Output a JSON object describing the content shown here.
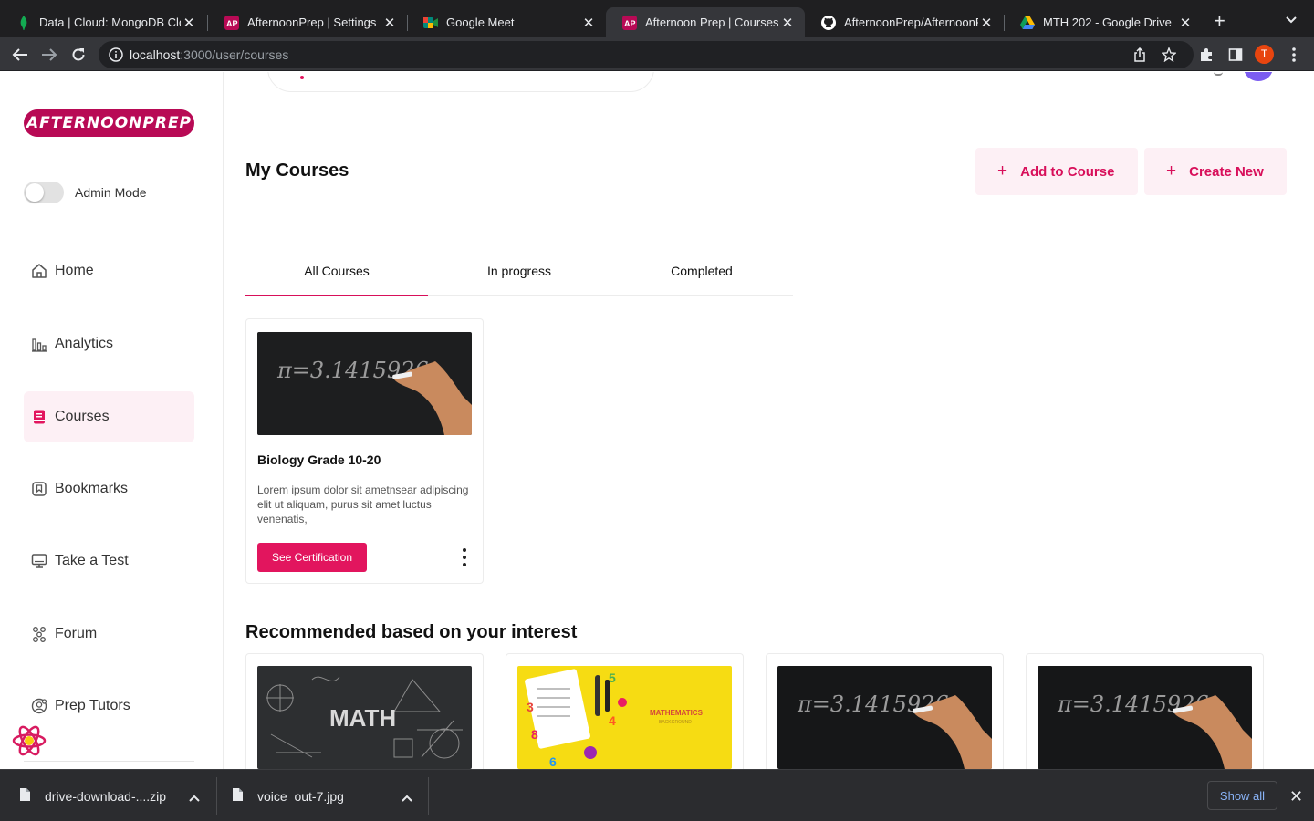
{
  "browser": {
    "tabs": [
      {
        "title": "Data | Cloud: MongoDB Clo",
        "icon": "mongodb-leaf-icon"
      },
      {
        "title": "AfternoonPrep | Settings",
        "icon": "afternoonprep-icon"
      },
      {
        "title": "Google Meet",
        "icon": "google-meet-icon"
      },
      {
        "title": "Afternoon Prep | Courses",
        "icon": "afternoonprep-icon"
      },
      {
        "title": "AfternoonPrep/AfternoonPr",
        "icon": "github-icon"
      },
      {
        "title": "MTH 202 - Google Drive",
        "icon": "google-drive-icon"
      }
    ],
    "active_tab": 3,
    "url_host": "localhost",
    "url_path": ":3000/user/courses",
    "profile_initial": "T",
    "colors": {
      "tabbar": "#1f1f21",
      "toolbar": "#35363a",
      "profile": "#e8450f"
    }
  },
  "sidebar": {
    "logo_text": "AFTERNOONPREP",
    "admin_label": "Admin Mode",
    "admin_on": false,
    "items": [
      {
        "label": "Home",
        "icon": "home-icon"
      },
      {
        "label": "Analytics",
        "icon": "analytics-icon"
      },
      {
        "label": "Courses",
        "icon": "courses-icon",
        "active": true
      },
      {
        "label": "Bookmarks",
        "icon": "bookmark-icon"
      },
      {
        "label": "Take a Test",
        "icon": "test-monitor-icon"
      },
      {
        "label": "Forum",
        "icon": "forum-icon"
      },
      {
        "label": "Prep Tutors",
        "icon": "tutors-icon"
      }
    ]
  },
  "main": {
    "title": "My Courses",
    "actions": {
      "add": "Add to Course",
      "create": "Create New"
    },
    "tabs": [
      "All Courses",
      "In progress",
      "Completed"
    ],
    "active_tab": 0,
    "course": {
      "title": "Biology Grade 10-20",
      "description": "Lorem ipsum dolor sit ametnsear adipiscing elit ut aliquam, purus sit amet luctus venenatis,",
      "button": "See Certification",
      "image": "chalkboard-pi"
    },
    "recommended_title": "Recommended based on your interest",
    "recommended": [
      {
        "image": "math-chalkboard",
        "image_text": "MATH"
      },
      {
        "image": "mathematics-yellow",
        "image_text": "MATHEMATICS",
        "image_subtext": "BACKGROUND"
      },
      {
        "image": "chalkboard-pi"
      },
      {
        "image": "chalkboard-pi"
      }
    ],
    "chalk_text": "π=3.1415926",
    "accent": "#e2155e"
  },
  "downloads": {
    "items": [
      {
        "name": "drive-download-....zip"
      },
      {
        "name": "voice  out-7.jpg"
      }
    ],
    "show_all": "Show all"
  }
}
